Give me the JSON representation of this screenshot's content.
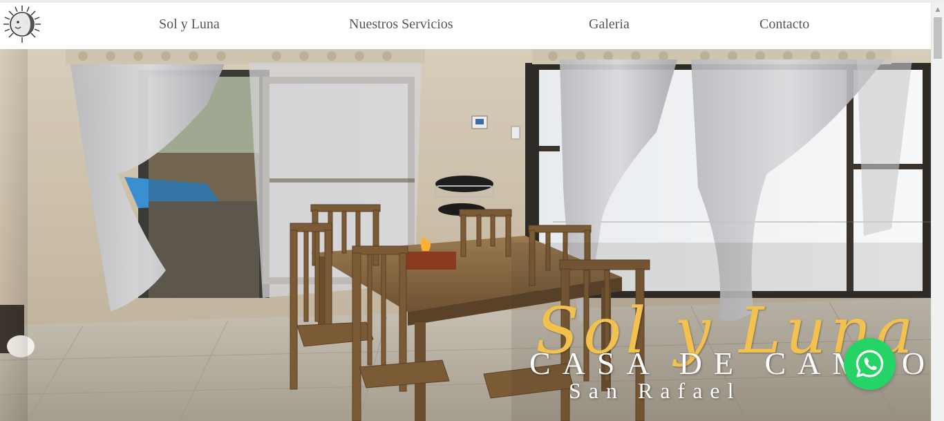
{
  "nav": {
    "logo_icon": "sun-moon-logo-icon",
    "links": [
      {
        "label": "Sol y Luna"
      },
      {
        "label": "Nuestros Servicios"
      },
      {
        "label": "Galeria"
      },
      {
        "label": "Contacto"
      }
    ]
  },
  "hero": {
    "title": "Sol y Luna",
    "subtitle": "CASA DE CAMPO",
    "location": "San Rafael",
    "image_description": "dining-room-photo",
    "colors": {
      "title": "#f2c14e",
      "subtitle": "#ffffff"
    }
  },
  "whatsapp": {
    "icon": "whatsapp-icon",
    "color": "#25d366"
  }
}
